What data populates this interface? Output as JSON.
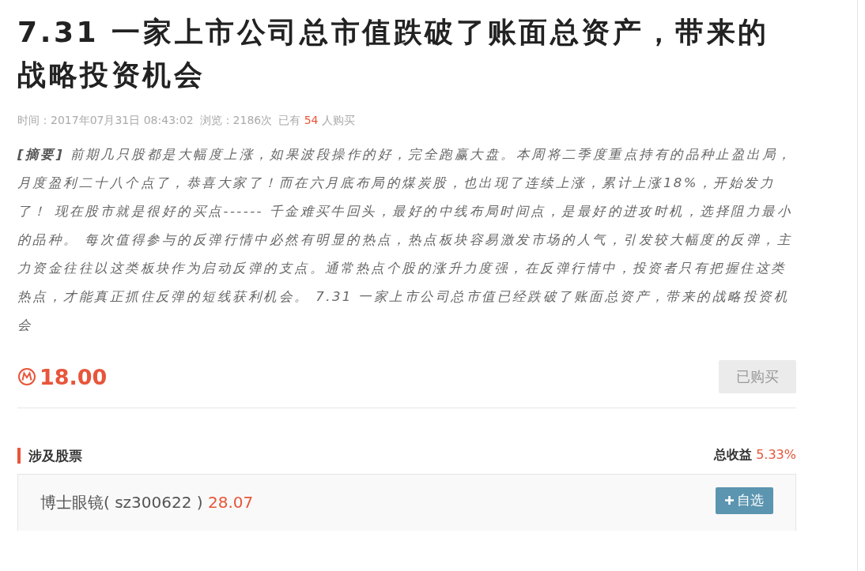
{
  "title": "7.31 一家上市公司总市值跌破了账面总资产，带来的战略投资机会",
  "meta": {
    "time": "时间：2017年07月31日 08:43:02",
    "views": "浏览：2186次",
    "bought_prefix": "已有",
    "bought_count": "54",
    "bought_suffix": "人购买"
  },
  "summary": "**[摘要]** 前期几只股都是大幅度上涨，如果波段操作的好，完全跑赢大盘。本周将二季度重点持有的品种止盈出局，月度盈利二十八个点了，恭喜大家了！而在六月底布局的煤炭股，也出现了连续上涨，累计上涨18%，开始发力了！ 现在股市就是很好的买点------ 千金难买牛回头，最好的中线布局时间点，是最好的进攻时机，选择阻力最小的品种。 每次值得参与的反弹行情中必然有明显的热点，热点板块容易激发市场的人气，引发较大幅度的反弹，主力资金往往以这类板块作为启动反弹的支点。通常热点个股的涨升力度强，在反弹行情中，投资者只有把握住这类热点，才能真正抓住反弹的短线获利机会。 7.31 一家上市公司总市值已经跌破了账面总资产，带来的战略投资机会",
  "price": "18.00",
  "buy_button": {
    "label": "已购买",
    "disabled": true
  },
  "section": {
    "title": "涉及股票",
    "total_label": "总收益",
    "total_value": "5.33%"
  },
  "stocks": [
    {
      "name": "博士眼镜( sz300622 )",
      "price": "28.07",
      "add_label": "自选"
    }
  ]
}
